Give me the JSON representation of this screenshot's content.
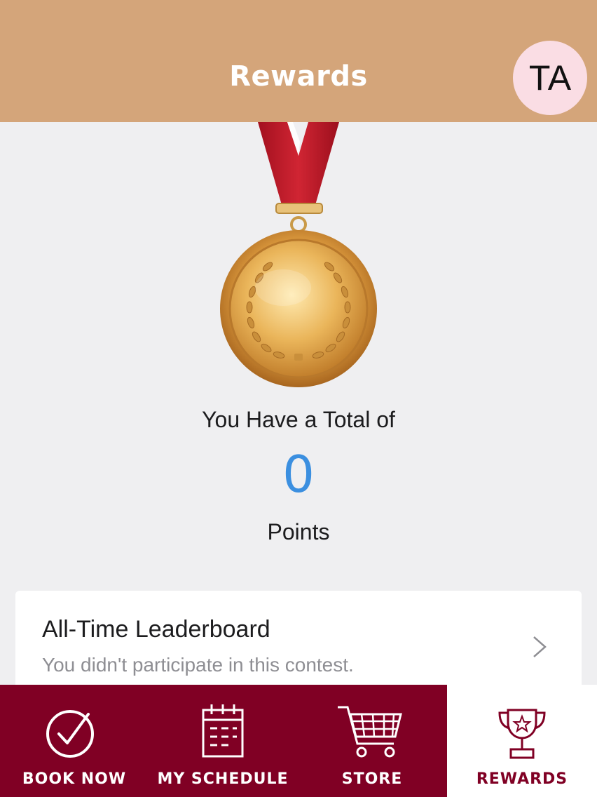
{
  "header": {
    "title": "Rewards",
    "avatar_initials": "TA",
    "background_color": "#d4a57a"
  },
  "medal": {
    "icon": "gold-medal-icon"
  },
  "points": {
    "total_label": "You Have a Total of",
    "value": "0",
    "unit_label": "Points",
    "value_color": "#3b8fe0"
  },
  "leaderboard": {
    "title": "All-Time Leaderboard",
    "subtitle": "You didn't participate in this contest."
  },
  "tabbar": {
    "brand_color": "#800024",
    "tabs": [
      {
        "label": "BOOK NOW",
        "icon": "check-circle-icon",
        "active": false
      },
      {
        "label": "MY SCHEDULE",
        "icon": "calendar-icon",
        "active": false
      },
      {
        "label": "STORE",
        "icon": "cart-icon",
        "active": false
      },
      {
        "label": "REWARDS",
        "icon": "trophy-icon",
        "active": true
      }
    ]
  }
}
